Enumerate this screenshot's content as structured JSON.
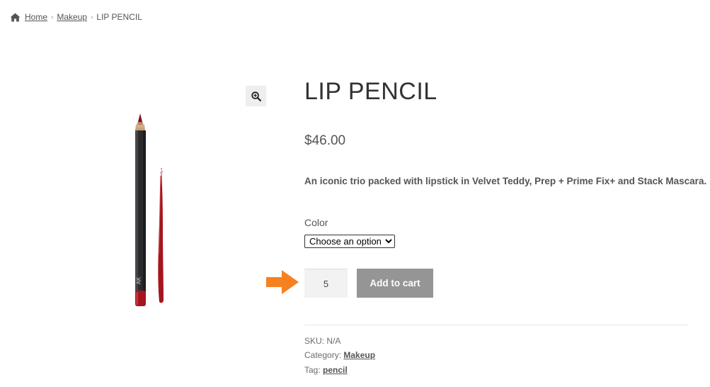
{
  "breadcrumb": {
    "home": "Home",
    "category": "Makeup",
    "current": "LIP PENCIL",
    "separator": "›"
  },
  "gallery": {
    "zoom_icon": "magnifier-plus-icon"
  },
  "product": {
    "title": "LIP PENCIL",
    "price": "$46.00",
    "description": "An iconic trio packed with lipstick in Velvet Teddy, Prep + Prime Fix+ and Stack Mascara.",
    "color_label": "Color",
    "color_selected": "Choose an option",
    "quantity": "5",
    "add_to_cart_label": "Add to cart"
  },
  "meta": {
    "sku_label": "SKU:",
    "sku_value": "N/A",
    "category_label": "Category:",
    "category_value": "Makeup",
    "tag_label": "Tag:",
    "tag_value": "pencil"
  },
  "colors": {
    "arrow": "#f5821f",
    "button_bg": "#959595",
    "pencil_red": "#a3161e"
  }
}
